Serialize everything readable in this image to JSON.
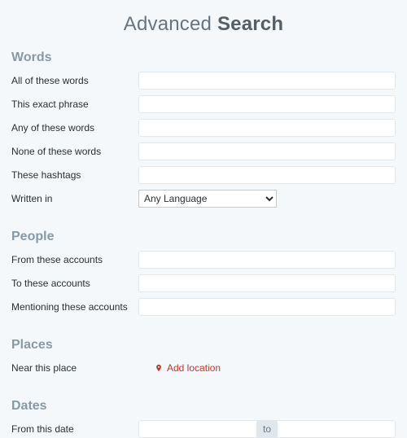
{
  "title": {
    "prefix": "Advanced ",
    "bold": "Search"
  },
  "sections": {
    "words": {
      "heading": "Words",
      "all": {
        "label": "All of these words",
        "value": ""
      },
      "exact": {
        "label": "This exact phrase",
        "value": ""
      },
      "any": {
        "label": "Any of these words",
        "value": ""
      },
      "none": {
        "label": "None of these words",
        "value": ""
      },
      "hashtags": {
        "label": "These hashtags",
        "value": ""
      },
      "language": {
        "label": "Written in",
        "selected": "Any Language"
      }
    },
    "people": {
      "heading": "People",
      "from": {
        "label": "From these accounts",
        "value": ""
      },
      "to": {
        "label": "To these accounts",
        "value": ""
      },
      "mentioning": {
        "label": "Mentioning these accounts",
        "value": ""
      }
    },
    "places": {
      "heading": "Places",
      "near": {
        "label": "Near this place",
        "action": "Add location"
      }
    },
    "dates": {
      "heading": "Dates",
      "from": {
        "label": "From this date",
        "from_value": "",
        "to_value": "",
        "separator": "to"
      }
    }
  }
}
